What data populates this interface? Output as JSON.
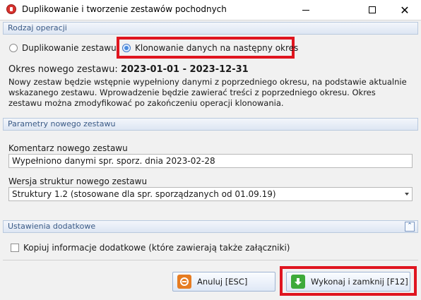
{
  "window": {
    "title": "Duplikowanie i tworzenie zestawów pochodnych",
    "minimize_glyph": "",
    "close_glyph": "✕"
  },
  "operation": {
    "header": "Rodzaj operacji",
    "options": [
      {
        "label": "Duplikowanie zestawu",
        "checked": false
      },
      {
        "label": "Klonowanie danych na następny okres",
        "checked": true
      }
    ],
    "period_label": "Okres nowego zestawu:",
    "period_value": "2023-01-01 - 2023-12-31",
    "description": "Nowy zestaw będzie wstępnie wypełniony danymi z poprzedniego okresu, na podstawie aktualnie wskazanego zestawu. Wprowadzenie będzie zawierać treści z poprzedniego okresu. Okres zestawu można zmodyfikować po zakończeniu operacji klonowania."
  },
  "params": {
    "header": "Parametry nowego zestawu",
    "comment_label": "Komentarz nowego zestawu",
    "comment_value": "Wypełniono danymi spr. sporz. dnia 2023-02-28",
    "structure_label": "Wersja struktur nowego zestawu",
    "structure_value": "Struktury 1.2 (stosowane dla spr. sporządzanych od 01.09.19)"
  },
  "extra": {
    "header": "Ustawienia dodatkowe",
    "collapse_glyph": "⌃",
    "copy_info_label": "Kopiuj informacje dodatkowe (które zawierają także załączniki)",
    "copy_info_checked": false
  },
  "buttons": {
    "cancel_label": "Anuluj [ESC]",
    "execute_label": "Wykonaj i zamknij [F12]"
  },
  "colors": {
    "highlight": "#e0151f",
    "group_header_text": "#3a5a86",
    "cancel_icon": "#e67c22",
    "execute_icon": "#3eaa3a"
  },
  "icons": {
    "app": "app-icon",
    "cancel": "cancel-icon",
    "execute": "download-icon",
    "collapse": "chevron-up-icon"
  }
}
